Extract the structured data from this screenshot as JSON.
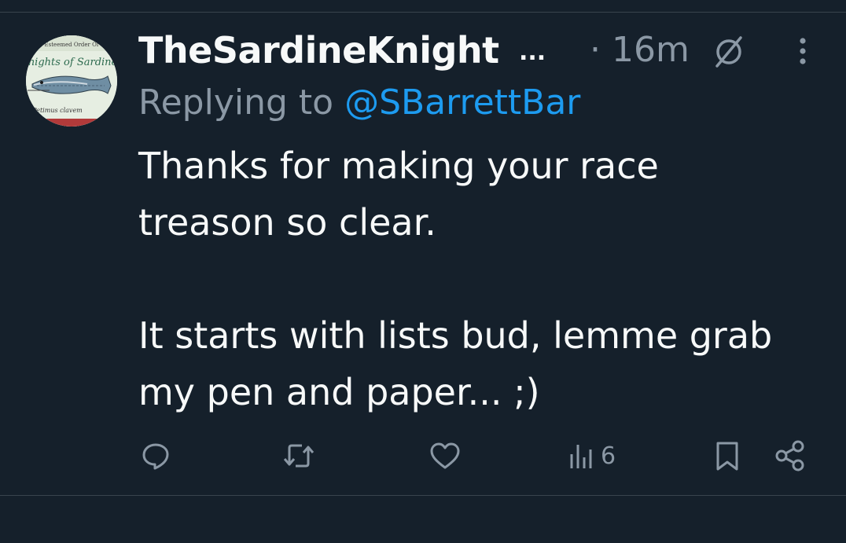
{
  "tweet": {
    "display_name": "TheSardineKnight",
    "name_truncation": "...",
    "time": "· 16m",
    "reply_prefix": "Replying to",
    "reply_handle": "@SBarrettBar",
    "text_lines": [
      "Thanks for making your race",
      "treason so clear.",
      "It starts with lists bud, lemme grab",
      "my pen and paper... ;)"
    ]
  },
  "avatar": {
    "top_text": "Esteemed Order Of",
    "main_text": "Knights of Sardines",
    "bottom_text": "Petimus clavem"
  },
  "actions": {
    "reply_icon": "reply-icon",
    "retweet_icon": "retweet-icon",
    "like_icon": "heart-icon",
    "views_icon": "views-icon",
    "views_count": "6",
    "bookmark_icon": "bookmark-icon",
    "share_icon": "share-icon"
  },
  "colors": {
    "background": "#15202b",
    "text": "#f7f9f9",
    "secondary_text": "#8b98a5",
    "link": "#1d9bf0",
    "divider": "#38444d"
  }
}
